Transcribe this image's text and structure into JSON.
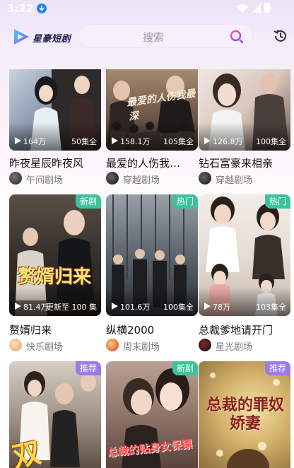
{
  "status_bar": {
    "time": "3:22"
  },
  "header": {
    "logo_text": "星豪短剧",
    "search_placeholder": "搜索"
  },
  "colors": {
    "badge_green": "#3cc39a",
    "badge_purple": "#9b7be8",
    "accent": "#7b4cff"
  },
  "cards": [
    {
      "title": "昨夜星辰昨夜风",
      "plays": "164万",
      "episodes": "50集全",
      "studio": "午间剧场",
      "badge": ""
    },
    {
      "title": "最爱的人伤我…",
      "plays": "158.1万",
      "episodes": "105集全",
      "studio": "穿越剧场",
      "badge": "",
      "poster_text": "最爱的人伤我最深"
    },
    {
      "title": "钻石富豪来相亲",
      "plays": "126.8万",
      "episodes": "100集全",
      "studio": "穿越剧场",
      "badge": ""
    },
    {
      "title": "赘婿归来",
      "plays": "81.4万",
      "episodes": "更新至 100 集",
      "studio": "快乐剧场",
      "badge": "新剧",
      "poster_text": "赘婿归来"
    },
    {
      "title": "纵横2000",
      "plays": "101.6万",
      "episodes": "100集全",
      "studio": "周末剧场",
      "badge": "热门"
    },
    {
      "title": "总裁爹地请开门",
      "plays": "78万",
      "episodes": "103集全",
      "studio": "星光剧场",
      "badge": "热门"
    },
    {
      "title": "",
      "plays": "",
      "episodes": "",
      "studio": "",
      "badge": "推荐",
      "poster_text": "双"
    },
    {
      "title": "",
      "plays": "",
      "episodes": "",
      "studio": "",
      "badge": "新剧",
      "poster_text": "总裁的贴身女保镖"
    },
    {
      "title": "",
      "plays": "",
      "episodes": "",
      "studio": "",
      "badge": "推荐",
      "poster_text": "总裁的罪奴娇妻"
    }
  ]
}
